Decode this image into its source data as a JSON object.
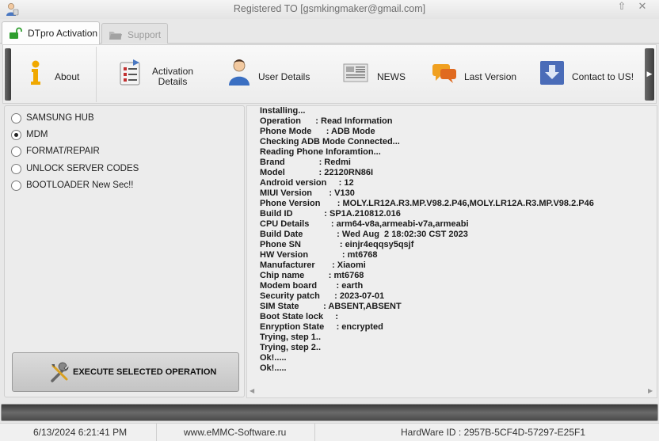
{
  "window": {
    "title": "Registered TO [gsmkingmaker@gmail.com]",
    "minimize_glyph": "⇧",
    "close_glyph": "✕"
  },
  "tabs": [
    {
      "label": "DTpro Activation",
      "icon": "unlock-icon",
      "active": true
    },
    {
      "label": "Support",
      "icon": "folder-icon",
      "active": false
    }
  ],
  "toolbar": {
    "items": [
      {
        "label": "About",
        "icon": "info-icon"
      },
      {
        "label": "Activation\nDetails",
        "icon": "checklist-icon"
      },
      {
        "label": "User Details",
        "icon": "user-icon"
      },
      {
        "label": "NEWS",
        "icon": "newspaper-icon"
      },
      {
        "label": "Last Version",
        "icon": "chat-bubbles-icon"
      },
      {
        "label": "Contact to US!",
        "icon": "download-box-icon"
      }
    ],
    "scroll_right_glyph": "▶"
  },
  "operations": {
    "options": [
      {
        "label": "SAMSUNG HUB",
        "checked": false
      },
      {
        "label": "MDM",
        "checked": true
      },
      {
        "label": "FORMAT/REPAIR",
        "checked": false
      },
      {
        "label": "UNLOCK SERVER CODES",
        "checked": false
      },
      {
        "label": "BOOTLOADER New Sec!!",
        "checked": false
      }
    ],
    "execute_label": "EXECUTE SELECTED OPERATION"
  },
  "log": {
    "lines": [
      "Installing...",
      "Operation      : Read Information",
      "Phone Mode      : ADB Mode",
      "Checking ADB Mode Connected...",
      "Reading Phone Inforamtion...",
      "Brand              : Redmi",
      "Model              : 22120RN86I",
      "Android version     : 12",
      "MIUI Version       : V130",
      "Phone Version       : MOLY.LR12A.R3.MP.V98.2.P46,MOLY.LR12A.R3.MP.V98.2.P46",
      "Build ID             : SP1A.210812.016",
      "CPU Details         : arm64-v8a,armeabi-v7a,armeabi",
      "Build Date              : Wed Aug  2 18:02:30 CST 2023",
      "Phone SN                : einjr4eqqsy5qsjf",
      "HW Version              : mt6768",
      "Manufacturer       : Xiaomi",
      "Chip name          : mt6768",
      "Modem board        : earth",
      "Security patch      : 2023-07-01",
      "SIM State          : ABSENT,ABSENT",
      "Boot State lock     :",
      "Enryption State     : encrypted",
      "Trying, step 1..",
      "Trying, step 2..",
      "Ok!.....",
      "Ok!....."
    ],
    "scroll_left_glyph": "◀",
    "scroll_right_glyph": "▶"
  },
  "progress": {
    "fraction": 0.0
  },
  "status": {
    "datetime": "6/13/2024 6:21:41 PM",
    "website": "www.eMMC-Software.ru",
    "hardware_id": "HardWare ID : 2957B-5CF4D-57297-E25F1"
  },
  "colors": {
    "accent_blue": "#2e8bd6",
    "info_yellow": "#f0a800",
    "unlock_green": "#2f9e2f"
  }
}
